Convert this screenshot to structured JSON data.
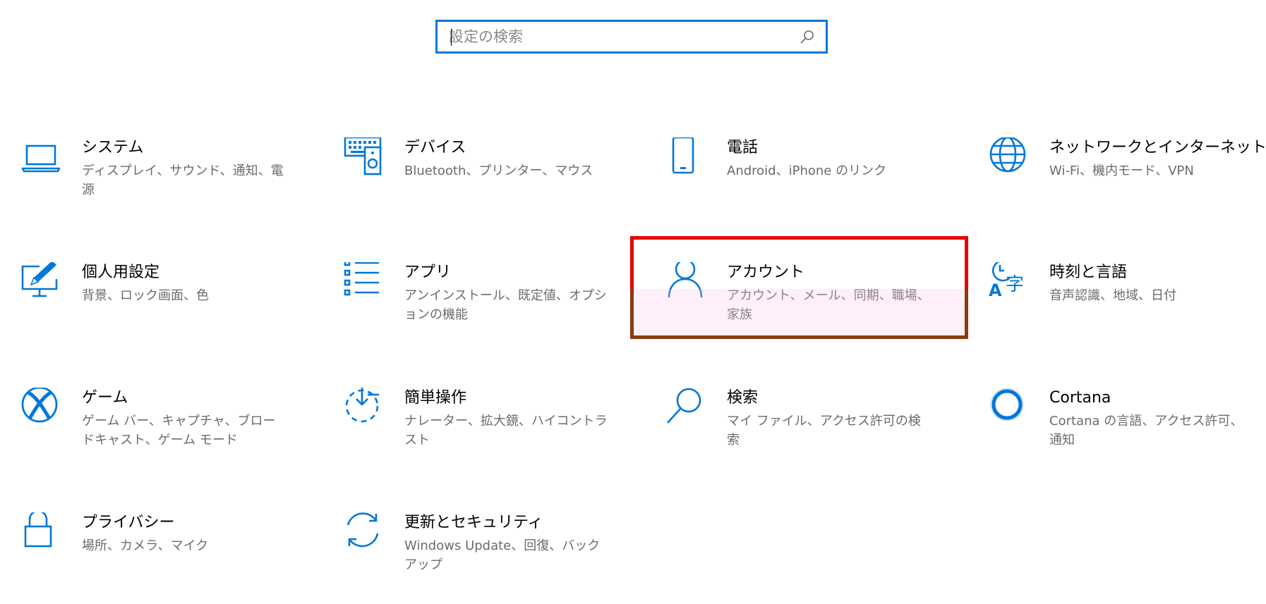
{
  "search": {
    "placeholder": "設定の検索"
  },
  "accent_color": "#0078d7",
  "highlight_color": "#e60000",
  "tiles": [
    {
      "title": "システム",
      "desc": "ディスプレイ、サウンド、通知、電源",
      "icon": "laptop-icon"
    },
    {
      "title": "デバイス",
      "desc": "Bluetooth、プリンター、マウス",
      "icon": "keyboard-speaker-icon"
    },
    {
      "title": "電話",
      "desc": "Android、iPhone のリンク",
      "icon": "phone-icon"
    },
    {
      "title": "ネットワークとインターネット",
      "desc": "Wi-Fi、機内モード、VPN",
      "icon": "globe-icon"
    },
    {
      "title": "個人用設定",
      "desc": "背景、ロック画面、色",
      "icon": "pen-monitor-icon"
    },
    {
      "title": "アプリ",
      "desc": "アンインストール、既定値、オプションの機能",
      "icon": "apps-list-icon"
    },
    {
      "title": "アカウント",
      "desc": "アカウント、メール、同期、職場、家族",
      "icon": "person-icon"
    },
    {
      "title": "時刻と言語",
      "desc": "音声認識、地域、日付",
      "icon": "time-language-icon"
    },
    {
      "title": "ゲーム",
      "desc": "ゲーム バー、キャプチャ、ブロードキャスト、ゲーム モード",
      "icon": "xbox-icon"
    },
    {
      "title": "簡単操作",
      "desc": "ナレーター、拡大鏡、ハイコントラスト",
      "icon": "ease-of-access-icon"
    },
    {
      "title": "検索",
      "desc": "マイ ファイル、アクセス許可の検索",
      "icon": "magnifier-icon"
    },
    {
      "title": "Cortana",
      "desc": "Cortana の言語、アクセス許可、通知",
      "icon": "cortana-circle-icon"
    },
    {
      "title": "プライバシー",
      "desc": "場所、カメラ、マイク",
      "icon": "lock-icon"
    },
    {
      "title": "更新とセキュリティ",
      "desc": "Windows Update、回復、バックアップ",
      "icon": "update-arrows-icon"
    }
  ]
}
